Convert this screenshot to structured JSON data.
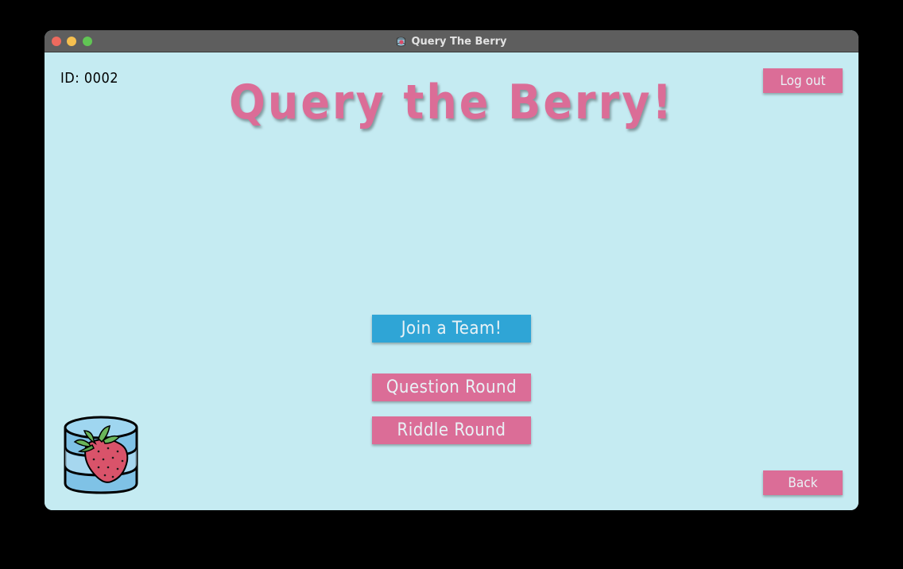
{
  "window": {
    "title": "Query The Berry"
  },
  "header": {
    "user_id": "ID: 0002",
    "heading": "Query the Berry!",
    "logout_label": "Log out"
  },
  "main": {
    "join_team_label": "Join a Team!",
    "question_round_label": "Question Round",
    "riddle_round_label": "Riddle Round"
  },
  "footer": {
    "back_label": "Back"
  },
  "icons": {
    "logo": "strawberry-database-logo-icon",
    "app": "app-icon"
  },
  "colors": {
    "background": "#c5ebf2",
    "accent_pink": "#db6d97",
    "accent_blue": "#2fa5d6",
    "button_text": "#e9f2f6",
    "titlebar": "#5e5e5e"
  }
}
